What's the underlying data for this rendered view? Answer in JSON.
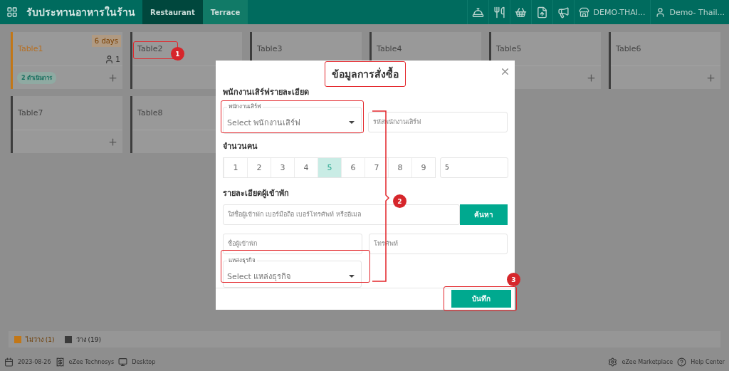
{
  "header": {
    "title": "รับประทานอาหารในร้าน",
    "tabs": [
      {
        "label": "Restaurant",
        "selected": true
      },
      {
        "label": "Terrace",
        "selected": false
      }
    ],
    "outlet": "DEMO-THAI...",
    "user": "Demo- Thail..."
  },
  "tables": [
    {
      "name": "Table1",
      "occupied": true,
      "duration": "6 days",
      "guests": "1",
      "status": "2 ดำเนินการ"
    },
    {
      "name": "Table2",
      "occupied": false
    },
    {
      "name": "Table3",
      "occupied": false
    },
    {
      "name": "Table4",
      "occupied": false
    },
    {
      "name": "Table5",
      "occupied": false
    },
    {
      "name": "Table6",
      "occupied": false
    },
    {
      "name": "Table7",
      "occupied": false
    },
    {
      "name": "Table8",
      "occupied": false
    }
  ],
  "legend": [
    {
      "label": "ไม่ว่าง (1)",
      "color": "#c27717"
    },
    {
      "label": "ว่าง (19)",
      "color": "#3a3a3a"
    }
  ],
  "footer": {
    "date": "2023-08-26",
    "company": "eZee Technosys",
    "device": "Desktop",
    "marketplace": "eZee Marketplace",
    "help": "Help Center"
  },
  "dialog": {
    "title": "ข้อมูลการสั่งซื้อ",
    "waiter_heading": "พนักงานเสิร์ฟรายละเอียด",
    "waiter_label": "พนักงานเสิร์ฟ",
    "waiter_placeholder": "Select พนักงานเสิร์ฟ",
    "waiter_code_placeholder": "รหัสพนักงานเสิร์ฟ",
    "pax_heading": "จำนวนคน",
    "pax_options": [
      {
        "label": "1",
        "selected": false
      },
      {
        "label": "2",
        "selected": false
      },
      {
        "label": "3",
        "selected": false
      },
      {
        "label": "4",
        "selected": false
      },
      {
        "label": "5",
        "selected": true
      },
      {
        "label": "6",
        "selected": false
      },
      {
        "label": "7",
        "selected": false
      },
      {
        "label": "8",
        "selected": false
      },
      {
        "label": "9",
        "selected": false
      }
    ],
    "pax_value": "5",
    "guest_heading": "รายละเอียดผู้เข้าพัก",
    "search_placeholder": "ใส่ชื่อผู้เข้าพัก เบอร์มือถือ เบอร์โทรศัพท์ หรืออีเมล",
    "search_button": "ค้นหา",
    "name_placeholder": "ชื่อผู้เข้าพัก",
    "phone_placeholder": "โทรศัพท์",
    "source_label": "แหล่งธุรกิจ",
    "source_placeholder": "Select แหล่งธุรกิจ",
    "save_button": "บันทึก"
  },
  "annotations": [
    {
      "number": "1"
    },
    {
      "number": "2"
    },
    {
      "number": "3"
    }
  ]
}
